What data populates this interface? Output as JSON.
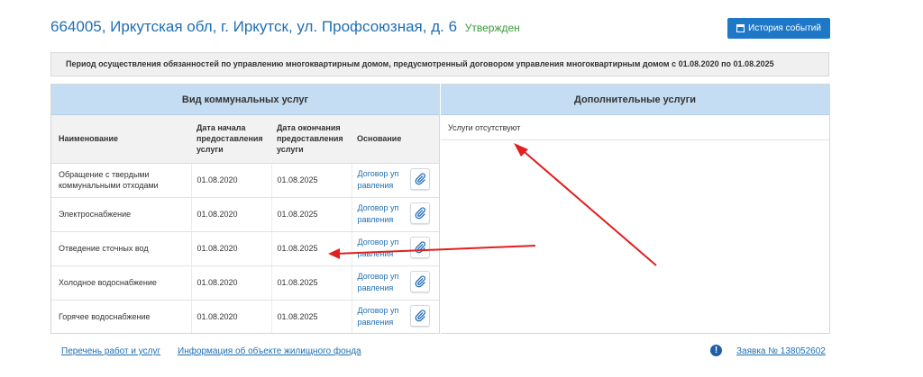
{
  "header": {
    "address": "664005, Иркутская обл, г. Иркутск, ул. Профсоюзная, д. 6",
    "status": "Утвержден",
    "history_button": "История событий"
  },
  "period_text": "Период осуществления обязанностей по управлению многоквартирным домом, предусмотренный договором управления многоквартирным домом с 01.08.2020 по 01.08.2025",
  "utilities": {
    "title": "Вид коммунальных услуг",
    "columns": {
      "name": "Наименование",
      "start": "Дата начала предоставления услуги",
      "end": "Дата окончания предоставления услуги",
      "basis": "Основание"
    },
    "rows": [
      {
        "name": "Обращение с твердыми коммунальными отходами",
        "start": "01.08.2020",
        "end": "01.08.2025",
        "basis": "Договор уп равления"
      },
      {
        "name": "Электроснабжение",
        "start": "01.08.2020",
        "end": "01.08.2025",
        "basis": "Договор уп равления"
      },
      {
        "name": "Отведение сточных вод",
        "start": "01.08.2020",
        "end": "01.08.2025",
        "basis": "Договор уп равления"
      },
      {
        "name": "Холодное водоснабжение",
        "start": "01.08.2020",
        "end": "01.08.2025",
        "basis": "Договор уп равления"
      },
      {
        "name": "Горячее водоснабжение",
        "start": "01.08.2020",
        "end": "01.08.2025",
        "basis": "Договор уп равления"
      }
    ]
  },
  "additional": {
    "title": "Дополнительные услуги",
    "empty_text": "Услуги отсутствуют"
  },
  "footer": {
    "works_link": "Перечень работ и услуг",
    "info_link": "Информация об объекте жилищного фонда",
    "info_icon": "!",
    "request_link": "Заявка № 138052602"
  },
  "colors": {
    "accent": "#1e78c8",
    "status_green": "#3c9a3c",
    "header_blue": "#c5ddf2",
    "annotation_arrow": "#e31e1e"
  }
}
